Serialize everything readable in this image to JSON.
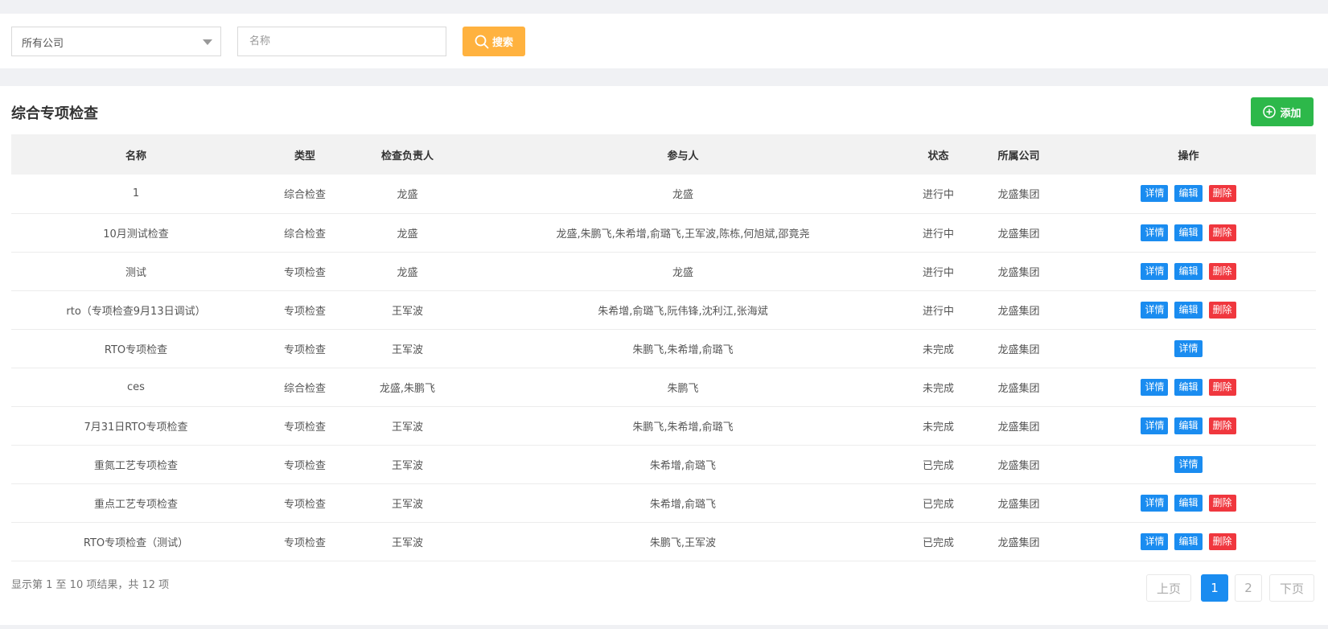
{
  "filter": {
    "company_select": "所有公司",
    "name_placeholder": "名称",
    "search_label": "搜索"
  },
  "panel": {
    "title": "综合专项检查",
    "add_label": "添加"
  },
  "table": {
    "headers": [
      "名称",
      "类型",
      "检查负责人",
      "参与人",
      "状态",
      "所属公司",
      "操作"
    ],
    "action_labels": {
      "detail": "详情",
      "edit": "编辑",
      "delete": "删除"
    },
    "rows": [
      {
        "name": "1",
        "type": "综合检查",
        "lead": "龙盛",
        "participants": "龙盛",
        "status": "进行中",
        "company": "龙盛集团"
      },
      {
        "name": "10月测试检查",
        "type": "综合检查",
        "lead": "龙盛",
        "participants": "龙盛,朱鹏飞,朱希增,俞璐飞,王军波,陈栋,何旭斌,邵竟尧",
        "status": "进行中",
        "company": "龙盛集团"
      },
      {
        "name": "测试",
        "type": "专项检查",
        "lead": "龙盛",
        "participants": "龙盛",
        "status": "进行中",
        "company": "龙盛集团"
      },
      {
        "name": "rto（专项检查9月13日调试）",
        "type": "专项检查",
        "lead": "王军波",
        "participants": "朱希增,俞璐飞,阮伟锋,沈利江,张海斌",
        "status": "进行中",
        "company": "龙盛集团"
      },
      {
        "name": "RTO专项检查",
        "type": "专项检查",
        "lead": "王军波",
        "participants": "朱鹏飞,朱希增,俞璐飞",
        "status": "未完成",
        "company": "龙盛集团"
      },
      {
        "name": "ces",
        "type": "综合检查",
        "lead": "龙盛,朱鹏飞",
        "participants": "朱鹏飞",
        "status": "未完成",
        "company": "龙盛集团"
      },
      {
        "name": "7月31日RTO专项检查",
        "type": "专项检查",
        "lead": "王军波",
        "participants": "朱鹏飞,朱希增,俞璐飞",
        "status": "未完成",
        "company": "龙盛集团"
      },
      {
        "name": "重氮工艺专项检查",
        "type": "专项检查",
        "lead": "王军波",
        "participants": "朱希增,俞璐飞",
        "status": "已完成",
        "company": "龙盛集团"
      },
      {
        "name": "重点工艺专项检查",
        "type": "专项检查",
        "lead": "王军波",
        "participants": "朱希增,俞璐飞",
        "status": "已完成",
        "company": "龙盛集团"
      },
      {
        "name": "RTO专项检查（测试）",
        "type": "专项检查",
        "lead": "王军波",
        "participants": "朱鹏飞,王军波",
        "status": "已完成",
        "company": "龙盛集团"
      }
    ]
  },
  "footer": {
    "summary": "显示第 1 至 10 项结果，共 12 项",
    "prev": "上页",
    "page1": "1",
    "page2": "2",
    "next": "下页"
  },
  "colors": {
    "search_button": "#ffb23f",
    "add_button": "#2db84a",
    "detail_button": "#1a8cf0",
    "edit_button": "#1a8cf0",
    "delete_button": "#f0373e",
    "active_page": "#1a8cf0"
  }
}
